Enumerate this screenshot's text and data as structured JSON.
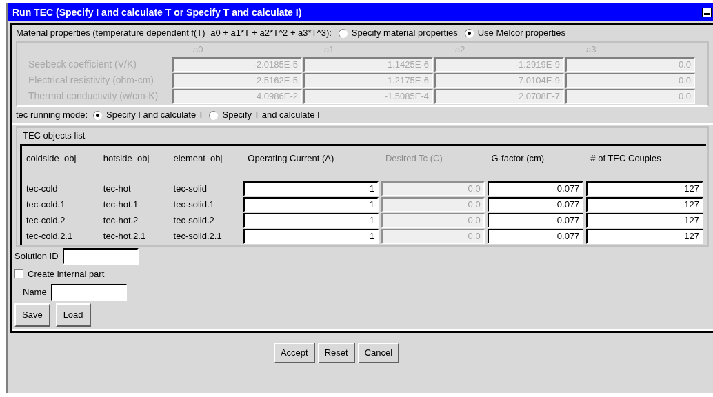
{
  "window": {
    "title": "Run TEC (Specify I and calculate T or Specify T and calculate I)"
  },
  "material": {
    "label": "Material properties (temperature dependent f(T)=a0 + a1*T + a2*T^2 + a3*T^3):",
    "options": [
      {
        "label": "Specify material properties",
        "selected": false
      },
      {
        "label": "Use Melcor properties",
        "selected": true
      }
    ],
    "disabled": true,
    "columns": [
      "a0",
      "a1",
      "a2",
      "a3"
    ],
    "rows": [
      {
        "label": "Seebeck coefficient (V/K)",
        "values": [
          "-2.0185E-5",
          "1.1425E-6",
          "-1.2919E-9",
          "0.0"
        ]
      },
      {
        "label": "Electrical resistivity (ohm-cm)",
        "values": [
          "2.5162E-5",
          "1.2175E-6",
          "7.0104E-9",
          "0.0"
        ]
      },
      {
        "label": "Thermal conductivity (w/cm-K)",
        "values": [
          "4.0986E-2",
          "-1.5085E-4",
          "2.0708E-7",
          "0.0"
        ]
      }
    ]
  },
  "mode": {
    "label": "tec running mode:",
    "options": [
      {
        "label": "Specify I and calculate T",
        "selected": true
      },
      {
        "label": "Specify T and calculate I",
        "selected": false
      }
    ]
  },
  "objects": {
    "title": "TEC objects list",
    "columns": [
      {
        "label": "coldside_obj",
        "kind": "text",
        "disabled": false
      },
      {
        "label": "hotside_obj",
        "kind": "text",
        "disabled": false
      },
      {
        "label": "element_obj",
        "kind": "text",
        "disabled": false
      },
      {
        "label": "Operating Current (A)",
        "kind": "field",
        "disabled": false
      },
      {
        "label": "Desired Tc (C)",
        "kind": "field",
        "disabled": true
      },
      {
        "label": "G-factor (cm)",
        "kind": "field",
        "disabled": false
      },
      {
        "label": "# of TEC Couples",
        "kind": "field",
        "disabled": false
      }
    ],
    "rows": [
      [
        "tec-cold",
        "tec-hot",
        "tec-solid",
        "1",
        "0.0",
        "0.077",
        "127"
      ],
      [
        "tec-cold.1",
        "tec-hot.1",
        "tec-solid.1",
        "1",
        "0.0",
        "0.077",
        "127"
      ],
      [
        "tec-cold.2",
        "tec-hot.2",
        "tec-solid.2",
        "1",
        "0.0",
        "0.077",
        "127"
      ],
      [
        "tec-cold.2.1",
        "tec-hot.2.1",
        "tec-solid.2.1",
        "1",
        "0.0",
        "0.077",
        "127"
      ]
    ]
  },
  "solution_id": {
    "label": "Solution ID"
  },
  "create_internal_part": {
    "label": "Create internal part",
    "checked": false
  },
  "name": {
    "label": "Name"
  },
  "file_buttons": [
    "Save",
    "Load"
  ],
  "buttons": [
    "Accept",
    "Reset",
    "Cancel"
  ]
}
